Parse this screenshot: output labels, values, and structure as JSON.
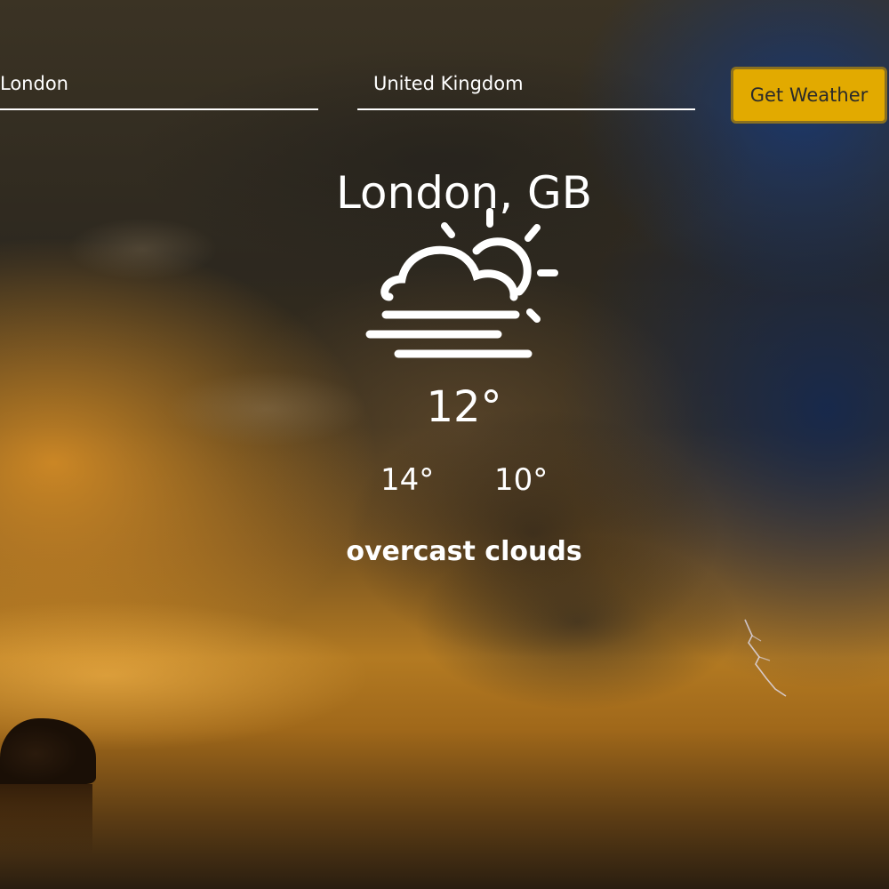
{
  "search": {
    "city_value": "London",
    "country_value": "United Kingdom",
    "button_label": "Get Weather"
  },
  "weather": {
    "location": "London, GB",
    "icon": "partly-cloudy-fog-icon",
    "temperature": "12°",
    "high": "14°",
    "low": "10°",
    "description": "overcast clouds"
  },
  "colors": {
    "button_bg": "#e2aa00",
    "text": "#ffffff"
  }
}
